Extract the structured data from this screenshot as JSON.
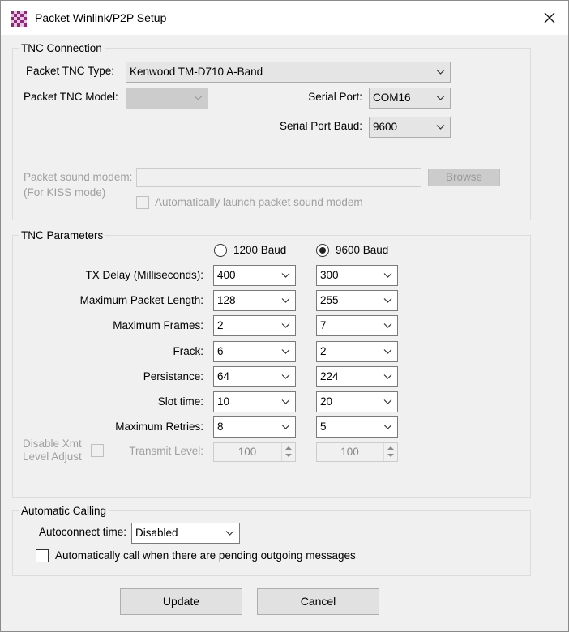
{
  "window": {
    "title": "Packet Winlink/P2P Setup"
  },
  "tnc_connection": {
    "legend": "TNC Connection",
    "type_label": "Packet TNC Type:",
    "type_value": "Kenwood TM-D710 A-Band",
    "model_label": "Packet TNC Model:",
    "model_value": "",
    "serial_port_label": "Serial Port:",
    "serial_port_value": "COM16",
    "serial_baud_label": "Serial Port Baud:",
    "serial_baud_value": "9600",
    "sound_modem_label": "Packet sound modem:",
    "kiss_mode_label": "(For KISS mode)",
    "sound_modem_path": "",
    "browse_label": "Browse",
    "auto_launch_label": "Automatically launch packet sound modem"
  },
  "tnc_parameters": {
    "legend": "TNC Parameters",
    "baud_1200_label": "1200 Baud",
    "baud_9600_label": "9600 Baud",
    "selected_baud": "9600",
    "rows": [
      {
        "label": "TX Delay (Milliseconds):",
        "v1200": "400",
        "v9600": "300"
      },
      {
        "label": "Maximum Packet Length:",
        "v1200": "128",
        "v9600": "255"
      },
      {
        "label": "Maximum Frames:",
        "v1200": "2",
        "v9600": "7"
      },
      {
        "label": "Frack:",
        "v1200": "6",
        "v9600": "2"
      },
      {
        "label": "Persistance:",
        "v1200": "64",
        "v9600": "224"
      },
      {
        "label": "Slot time:",
        "v1200": "10",
        "v9600": "20"
      },
      {
        "label": "Maximum Retries:",
        "v1200": "8",
        "v9600": "5"
      }
    ],
    "disable_xmt_line1": "Disable Xmt",
    "disable_xmt_line2": "Level Adjust",
    "transmit_level_label": "Transmit Level:",
    "transmit_level_1200": "100",
    "transmit_level_9600": "100"
  },
  "automatic_calling": {
    "legend": "Automatic Calling",
    "autoconnect_label": "Autoconnect time:",
    "autoconnect_value": "Disabled",
    "auto_call_label": "Automatically call when there are pending outgoing messages"
  },
  "buttons": {
    "update": "Update",
    "cancel": "Cancel"
  },
  "icons": {
    "app": "checkerboard-app-icon",
    "close": "close-icon",
    "dropdown": "chevron-down-icon"
  },
  "colors": {
    "app_icon_primary": "#8b2a7a",
    "app_icon_secondary": "#e9c8e2"
  }
}
